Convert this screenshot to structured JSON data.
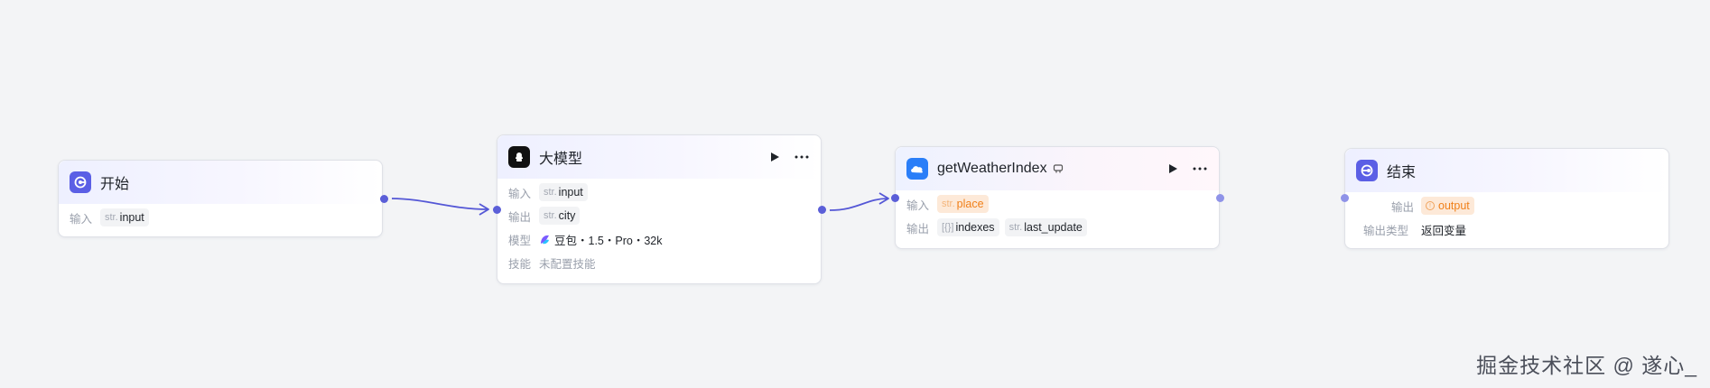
{
  "nodes": {
    "start": {
      "title": "开始",
      "input_label": "输入",
      "input_type": "str.",
      "input_name": "input"
    },
    "llm": {
      "title": "大模型",
      "input_label": "输入",
      "input_type": "str.",
      "input_name": "input",
      "output_label": "输出",
      "output_type": "str.",
      "output_name": "city",
      "model_label": "模型",
      "model_value": "豆包・1.5・Pro・32k",
      "skill_label": "技能",
      "skill_value": "未配置技能"
    },
    "weather": {
      "title": "getWeatherIndex",
      "input_label": "输入",
      "input_type": "str.",
      "input_name": "place",
      "output_label": "输出",
      "output1_type": "[{}]",
      "output1_name": "indexes",
      "output2_type": "str.",
      "output2_name": "last_update"
    },
    "end": {
      "title": "结束",
      "output_label": "输出",
      "output_name": "output",
      "output_type_label": "输出类型",
      "output_type_value": "返回变量"
    }
  },
  "icons": {
    "start": "start-node-icon",
    "llm": "llm-model-icon",
    "weather": "weather-cloud-icon",
    "end": "end-node-icon",
    "plugin": "plugin-badge-icon",
    "run": "play-icon",
    "more": "more-dots-icon",
    "model": "doubao-logo-icon",
    "warning": "warning-circle-icon"
  },
  "colors": {
    "accent": "#5b5fd8",
    "warning": "#f0801a",
    "canvas": "#f3f4f6"
  },
  "watermark": "掘金技术社区 @ 遂心_"
}
